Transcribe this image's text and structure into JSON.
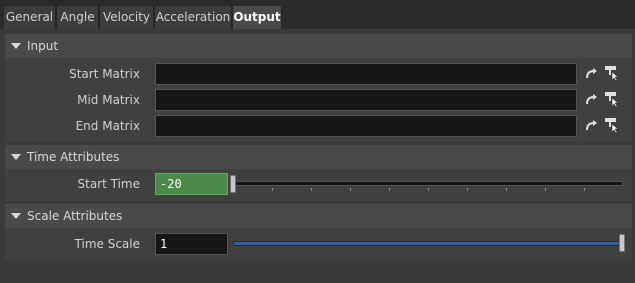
{
  "tabs": [
    {
      "label": "General"
    },
    {
      "label": "Angle"
    },
    {
      "label": "Velocity"
    },
    {
      "label": "Acceleration"
    },
    {
      "label": "Output"
    }
  ],
  "sections": {
    "input": {
      "title": "Input",
      "rows": [
        {
          "label": "Start Matrix",
          "value": ""
        },
        {
          "label": "Mid Matrix",
          "value": ""
        },
        {
          "label": "End Matrix",
          "value": ""
        }
      ]
    },
    "time": {
      "title": "Time Attributes",
      "start_time_label": "Start Time",
      "start_time_value": "-20"
    },
    "scale": {
      "title": "Scale Attributes",
      "time_scale_label": "Time Scale",
      "time_scale_value": "1"
    }
  },
  "colors": {
    "highlight_field": "#4b8a4b",
    "slider_fill": "#3b5f96"
  },
  "icons": {
    "connect": "curved-arrow-icon",
    "select": "select-cursor-icon"
  }
}
